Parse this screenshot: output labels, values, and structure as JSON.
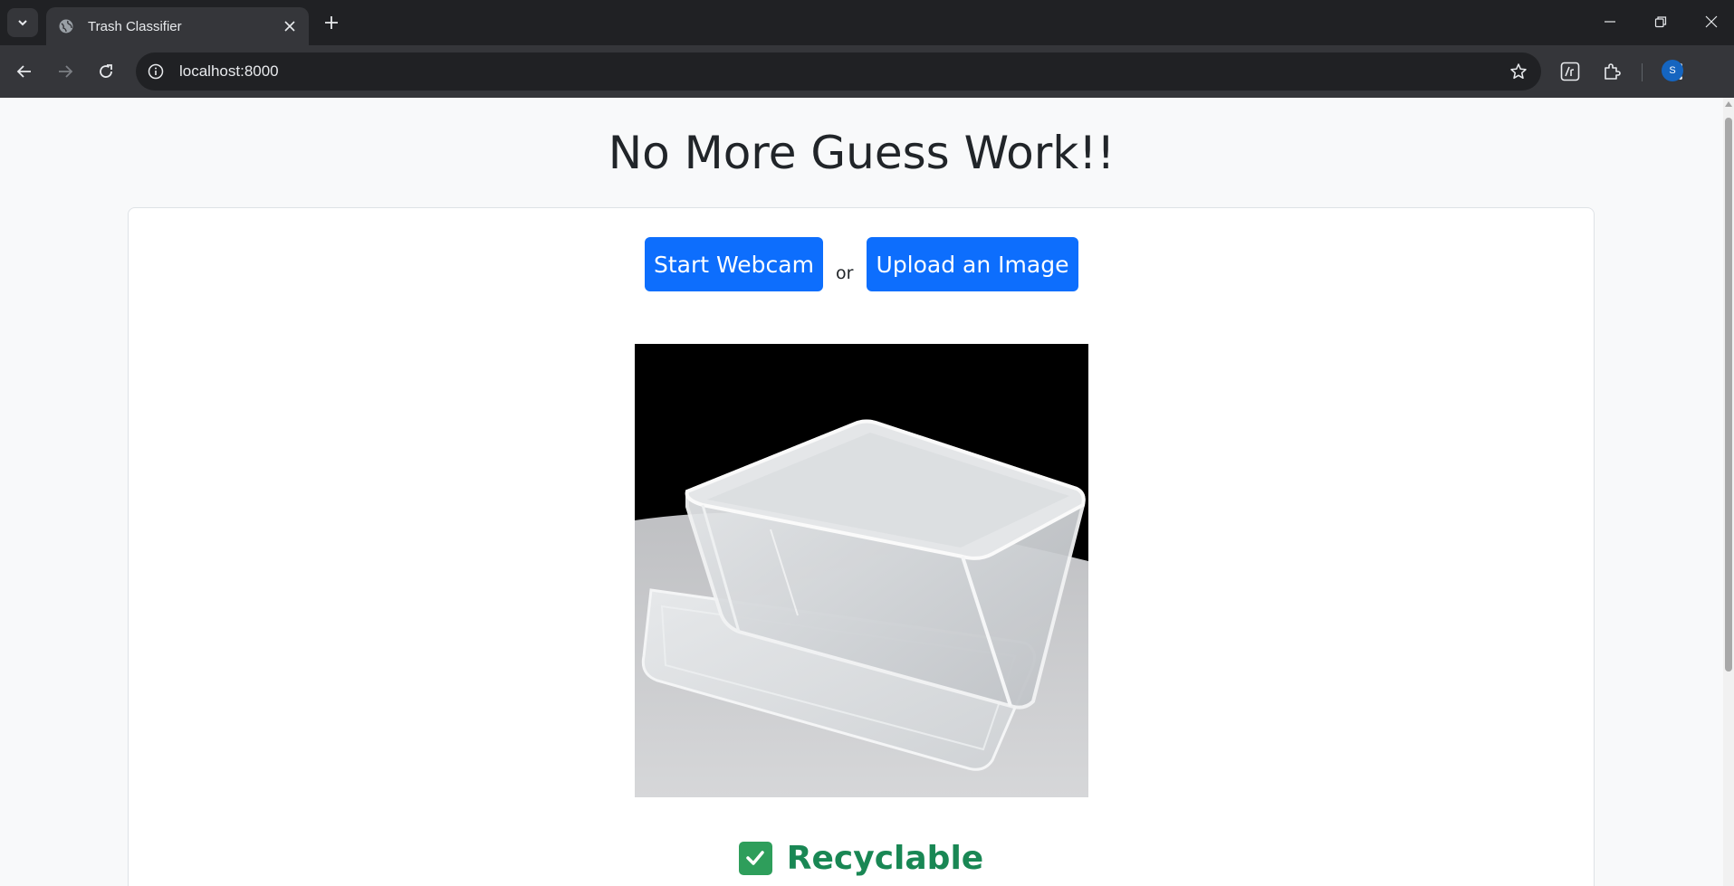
{
  "browser": {
    "tab_title": "Trash Classifier",
    "url": "localhost:8000",
    "profile_initial": "S"
  },
  "icons": {
    "tab_search": "chevron-down-icon",
    "favicon": "globe-icon",
    "tab_close": "close-icon",
    "new_tab": "plus-icon",
    "back": "arrow-left-icon",
    "forward": "arrow-right-icon",
    "reload": "reload-icon",
    "site_info": "info-icon",
    "bookmark": "star-icon",
    "extension": "puzzle-icon",
    "menu": "kebab-menu-icon"
  },
  "page": {
    "title": "No More Guess Work!!",
    "start_webcam_label": "Start Webcam",
    "or_label": "or",
    "upload_label": "Upload an Image",
    "result_label": "Recyclable"
  },
  "colors": {
    "primary_button": "#0d6efd",
    "result_green": "#198754",
    "check_green": "#2e9e5b"
  }
}
